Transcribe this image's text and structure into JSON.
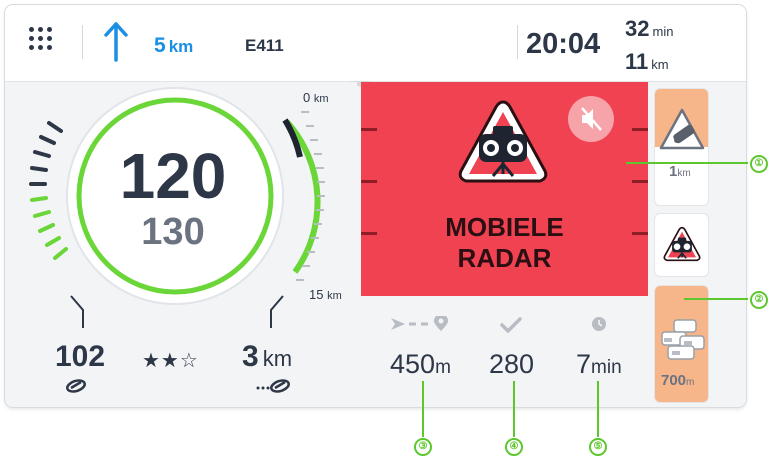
{
  "topbar": {
    "menu_icon": "grid-menu-icon",
    "turn_icon": "straight-arrow-icon",
    "distance_value": "5",
    "distance_unit": "km",
    "road_name": "E411",
    "arrival_time": "20:04",
    "remaining_time_value": "32",
    "remaining_time_unit": "min",
    "remaining_distance_value": "11",
    "remaining_distance_unit": "km"
  },
  "speedometer": {
    "current_speed": "120",
    "speed_limit": "130",
    "range_top_value": "0",
    "range_top_unit": "km",
    "range_bottom_value": "15",
    "range_bottom_unit": "km",
    "left_value": "102",
    "left_icon": "coyote-icon",
    "rating_stars": "★★☆",
    "rating": 2,
    "rating_max": 3,
    "right_value": "3",
    "right_unit": "km",
    "right_icon": "coyote-dots-icon"
  },
  "alert": {
    "icon": "speed-camera-warning-icon",
    "line1": "MOBIELE",
    "line2": "RADAR",
    "mute_icon": "sound-muted-icon",
    "background": "#f04250"
  },
  "info": {
    "distance_icon": "route-distance-icon",
    "distance_value": "450",
    "distance_unit": "m",
    "confirmations_icon": "checkmark-icon",
    "confirmations_value": "280",
    "time_icon": "clock-icon",
    "time_value": "7",
    "time_unit": "min"
  },
  "rail": {
    "card1_icon": "accident-warning-icon",
    "card1_value": "1",
    "card1_unit": "km",
    "card2_icon": "speed-camera-small-icon",
    "card3_icon": "traffic-jam-icon",
    "card3_value": "700",
    "card3_unit": "m"
  },
  "callouts": {
    "c1": "①",
    "c2": "②",
    "c3": "③",
    "c4": "④",
    "c5": "⑤"
  },
  "colors": {
    "accent_blue": "#1a8fe3",
    "alert_red": "#f04250",
    "gauge_green": "#6ad637",
    "callout_green": "#5dc72e"
  }
}
